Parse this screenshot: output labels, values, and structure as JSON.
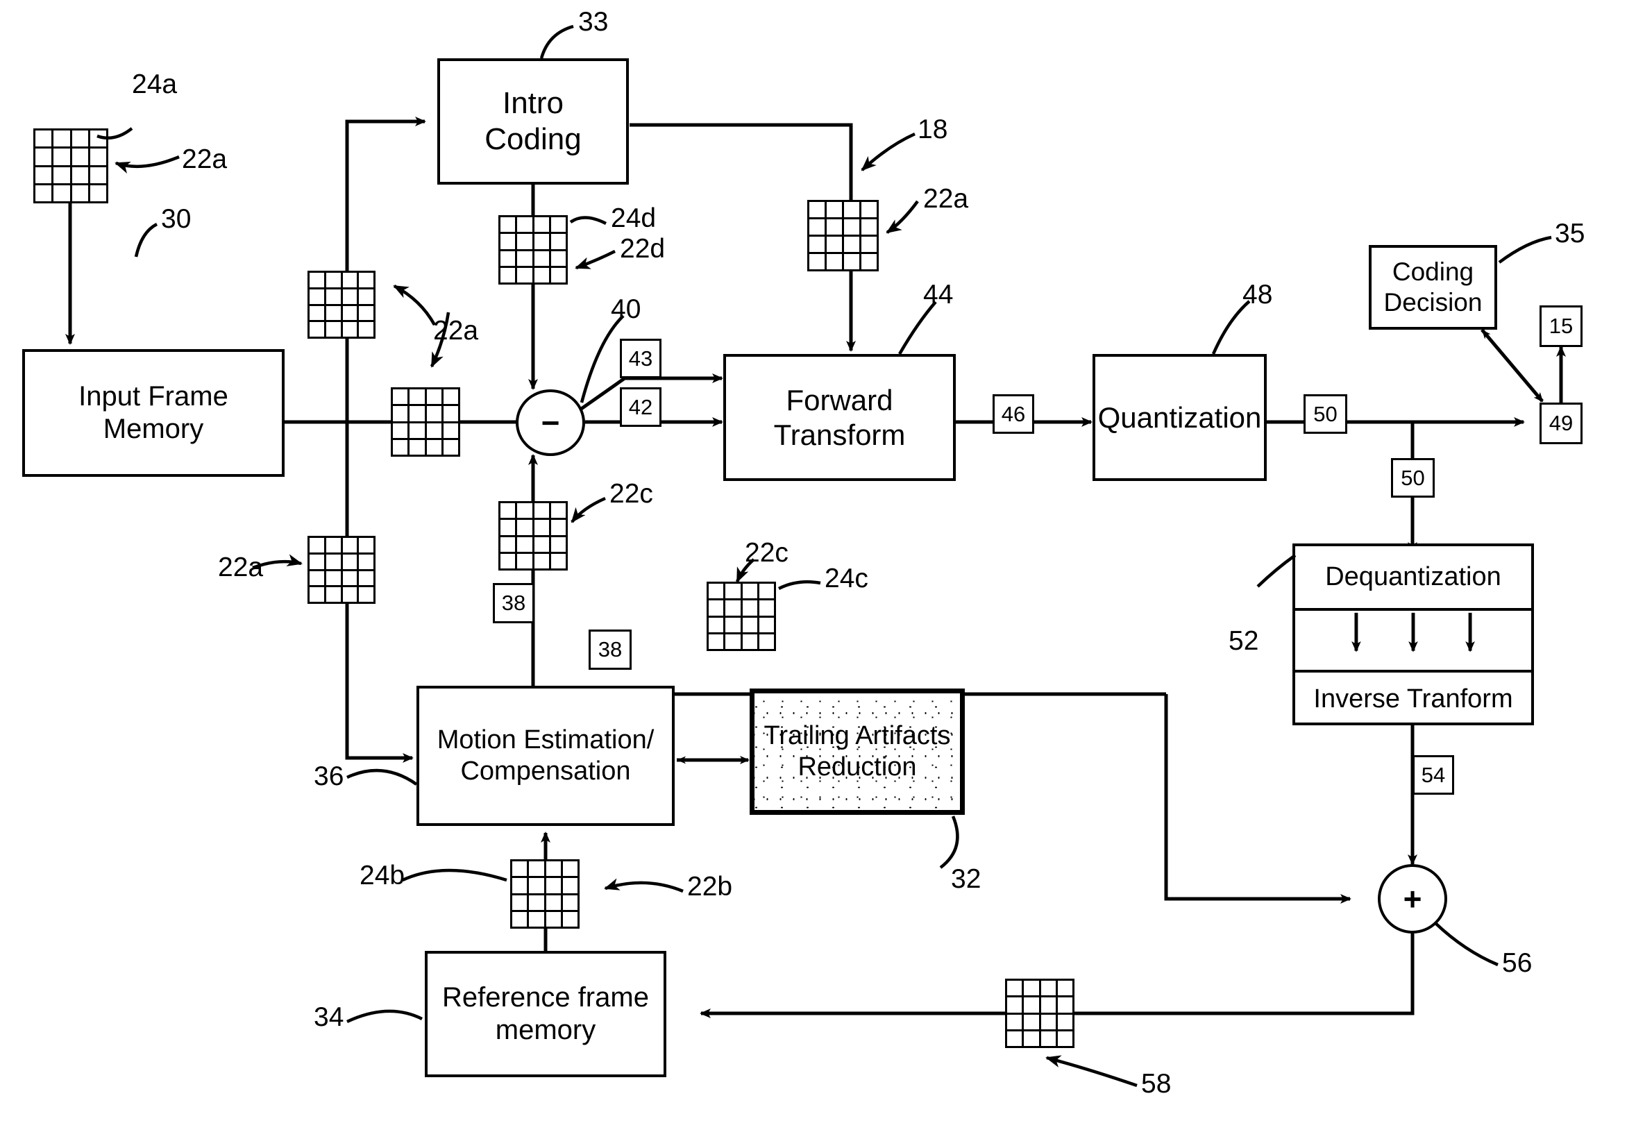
{
  "diagram": {
    "type": "video-encoder-block-diagram",
    "blocks": [
      {
        "id": "intro_coding",
        "label": "Intro\nCoding",
        "ref": "33"
      },
      {
        "id": "input_frame_memory",
        "label": "Input Frame Memory",
        "ref": "30"
      },
      {
        "id": "forward_transform",
        "label": "Forward Transform",
        "ref": "44"
      },
      {
        "id": "quantization",
        "label": "Quantization",
        "ref": "48"
      },
      {
        "id": "coding_decision",
        "label": "Coding\nDecision",
        "ref": "35"
      },
      {
        "id": "dequantization",
        "label": "Dequantization",
        "ref": "52"
      },
      {
        "id": "inverse_transform",
        "label": "Inverse Tranform",
        "ref": "52"
      },
      {
        "id": "motion_estimation",
        "label": "Motion Estimation/\nCompensation",
        "ref": "36"
      },
      {
        "id": "trailing_artifacts",
        "label": "Trailing Artifacts\nReduction",
        "ref": "32"
      },
      {
        "id": "reference_frame_mem",
        "label": "Reference frame\nmemory",
        "ref": "34"
      }
    ],
    "block_text": {
      "intro_coding_l1": "Intro",
      "intro_coding_l2": "Coding",
      "input_frame_memory": "Input Frame Memory",
      "forward_transform": "Forward Transform",
      "quantization": "Quantization",
      "coding_decision_l1": "Coding",
      "coding_decision_l2": "Decision",
      "dequantization": "Dequantization",
      "inverse_transform": "Inverse Tranform",
      "motion_estimation_l1": "Motion Estimation/",
      "motion_estimation_l2": "Compensation",
      "trailing_artifacts_l1": "Trailing Artifacts",
      "trailing_artifacts_l2": "Reduction",
      "reference_frame_mem_l1": "Reference frame",
      "reference_frame_mem_l2": "memory"
    },
    "signal_boxes": [
      {
        "id": "sig43",
        "value": "43"
      },
      {
        "id": "sig42",
        "value": "42"
      },
      {
        "id": "sig46",
        "value": "46"
      },
      {
        "id": "sig50a",
        "value": "50"
      },
      {
        "id": "sig50b",
        "value": "50"
      },
      {
        "id": "sig54",
        "value": "54"
      },
      {
        "id": "sig38a",
        "value": "38"
      },
      {
        "id": "sig38b",
        "value": "38"
      },
      {
        "id": "sig15",
        "value": "15"
      },
      {
        "id": "sig49",
        "value": "49"
      }
    ],
    "reference_labels": [
      {
        "id": "ref24a",
        "text": "24a"
      },
      {
        "id": "ref22a1",
        "text": "22a"
      },
      {
        "id": "ref33",
        "text": "33"
      },
      {
        "id": "ref18",
        "text": "18"
      },
      {
        "id": "ref22a2",
        "text": "22a"
      },
      {
        "id": "ref30",
        "text": "30"
      },
      {
        "id": "ref24d",
        "text": "24d"
      },
      {
        "id": "ref22d",
        "text": "22d"
      },
      {
        "id": "ref40",
        "text": "40"
      },
      {
        "id": "ref44",
        "text": "44"
      },
      {
        "id": "ref48",
        "text": "48"
      },
      {
        "id": "ref35",
        "text": "35"
      },
      {
        "id": "ref22a3",
        "text": "22a"
      },
      {
        "id": "ref22c1",
        "text": "22c"
      },
      {
        "id": "ref22c2",
        "text": "22c"
      },
      {
        "id": "ref24c",
        "text": "24c"
      },
      {
        "id": "ref22a4",
        "text": "22a"
      },
      {
        "id": "ref52",
        "text": "52"
      },
      {
        "id": "ref36",
        "text": "36"
      },
      {
        "id": "ref32",
        "text": "32"
      },
      {
        "id": "ref24b",
        "text": "24b"
      },
      {
        "id": "ref22b",
        "text": "22b"
      },
      {
        "id": "ref34",
        "text": "34"
      },
      {
        "id": "ref56",
        "text": "56"
      },
      {
        "id": "ref58",
        "text": "58"
      }
    ],
    "operators": [
      {
        "id": "subtract_node",
        "glyph": "−",
        "ref": "40"
      },
      {
        "id": "sum_node",
        "glyph": "+",
        "ref": "56"
      }
    ],
    "macroblock_icons": [
      "mb-24a",
      "mb-22a-left",
      "mb-22a-mid",
      "mb-22a-lower",
      "mb-18-22a",
      "mb-22d",
      "mb-22c-sub",
      "mb-24c",
      "mb-22b",
      "mb-58"
    ],
    "colors": {
      "line": "#000000",
      "fill": "#ffffff"
    }
  }
}
